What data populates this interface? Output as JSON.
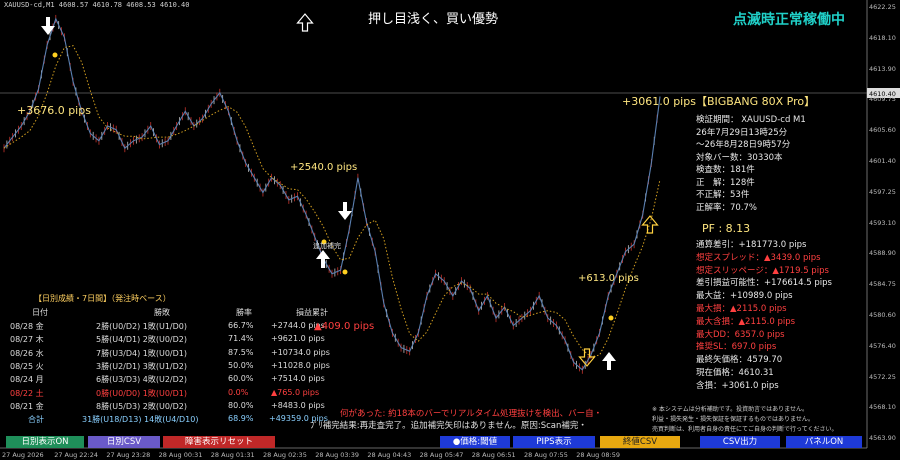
{
  "header": {
    "symbol_line": "XAUUSD-cd,M1  4608.57 4610.78 4608.53 4610.40"
  },
  "signal_text": "押し目浅く、買い優勢",
  "status_text": "点滅時正常稼働中",
  "pips_labels": [
    "+3676.0 pips",
    "+2540.0 pips",
    "+613.0 pips",
    "+3061.0 pips"
  ],
  "mid_label": "追加補完",
  "current_price_tag": "4610.40",
  "y_axis": [
    "4622.25",
    "4618.10",
    "4613.90",
    "4609.75",
    "4605.60",
    "4601.40",
    "4597.25",
    "4593.10",
    "4588.90",
    "4584.75",
    "4580.60",
    "4576.40",
    "4572.25",
    "4568.10",
    "4563.90"
  ],
  "x_axis": [
    "27 Aug 2026",
    "27 Aug 22:24",
    "27 Aug 23:28",
    "28 Aug 00:31",
    "28 Aug 01:31",
    "28 Aug 02:35",
    "28 Aug 03:39",
    "28 Aug 04:43",
    "28 Aug 05:47",
    "28 Aug 06:51",
    "28 Aug 07:55",
    "28 Aug 08:59"
  ],
  "panel_right": {
    "title": "【BIGBANG 80X Pro】",
    "lines": [
      {
        "t": "検証期間：  XAUUSD-cd M1",
        "red": false
      },
      {
        "t": "26年7月29日13時25分",
        "red": false
      },
      {
        "t": "～26年8月28日9時57分",
        "red": false
      },
      {
        "t": "対象バー数：30330本",
        "red": false
      },
      {
        "t": "検査数：181件",
        "red": false
      },
      {
        "t": "正　解：128件",
        "red": false
      },
      {
        "t": "不正解：53件",
        "red": false
      },
      {
        "t": "正解率：70.7%",
        "red": false
      }
    ],
    "pf": "PF  : 8.13",
    "lines2": [
      {
        "t": "通算差引：+181773.0 pips",
        "red": false
      },
      {
        "t": "想定スプレッド：▲3439.0 pips",
        "red": true
      },
      {
        "t": "想定スリッページ：▲1719.5 pips",
        "red": true
      },
      {
        "t": "差引損益可能性：+176614.5 pips",
        "red": false
      },
      {
        "t": "最大益：+10989.0 pips",
        "red": false
      },
      {
        "t": "最大損：▲2115.0 pips",
        "red": true
      },
      {
        "t": "最大含損：▲2115.0 pips",
        "red": true
      },
      {
        "t": "最大DD：6357.0 pips",
        "red": true
      },
      {
        "t": "推奨SL：697.0 pips",
        "red": true
      },
      {
        "t": "最終矢価格：4579.70",
        "red": false
      },
      {
        "t": "現在価格：4610.31",
        "red": false
      },
      {
        "t": "含損：+3061.0 pips",
        "red": false
      }
    ]
  },
  "daily_table": {
    "caption": "【日別成績・7日間】（発注時ベース）",
    "headers": [
      "日付",
      "勝敗",
      "勝率",
      "損益累計"
    ],
    "rows": [
      {
        "d": "08/28 金",
        "wl": "2勝(U0/D2) 1敗(U1/D0)",
        "rate": "66.7%",
        "pl": "+2744.0 pips",
        "red": false
      },
      {
        "d": "08/27 木",
        "wl": "5勝(U4/D1) 2敗(U0/D2)",
        "rate": "71.4%",
        "pl": "+9621.0 pips",
        "red": false
      },
      {
        "d": "08/26 水",
        "wl": "7勝(U3/D4) 1敗(U0/D1)",
        "rate": "87.5%",
        "pl": "+10734.0 pips",
        "red": false
      },
      {
        "d": "08/25 火",
        "wl": "3勝(U2/D1) 3敗(U1/D2)",
        "rate": "50.0%",
        "pl": "+11028.0 pips",
        "red": false
      },
      {
        "d": "08/24 月",
        "wl": "6勝(U3/D3) 4敗(U2/D2)",
        "rate": "60.0%",
        "pl": "+7514.0 pips",
        "red": false
      },
      {
        "d": "08/22 土",
        "wl": "0勝(U0/D0) 1敗(U0/D1)",
        "rate": "0.0%",
        "pl": "▲765.0 pips",
        "red": true
      },
      {
        "d": "08/21 金",
        "wl": "8勝(U5/D3) 2敗(U0/D2)",
        "rate": "80.0%",
        "pl": "+8483.0 pips",
        "red": false
      }
    ],
    "total": {
      "d": "合計",
      "wl": "31勝(U18/D13) 14敗(U4/D10)",
      "rate": "68.9%",
      "pl": "+49359.0 pips"
    },
    "overlap_text": "▲409.0 pips"
  },
  "message": {
    "line1": "何があった: 約18本のバーでリアルタイム処理抜けを検出、バー自・",
    "line2": "ﾌﾟﾘ補完結果:再走査完了。追加補完矢印はありません。原因:Scan補完・"
  },
  "notes": [
    "※ 本システムは分析補助です。投資助言ではありません。",
    "利益・損失発生・損失保証を保証するものではありません。",
    "売買判断は、利用者自身の責任にてご自身の判断で行ってください。"
  ],
  "buttons_left": [
    {
      "label": "日別表示ON",
      "bg": "#1f8f5a"
    },
    {
      "label": "日別CSV",
      "bg": "#6a5ac8"
    },
    {
      "label": "障害表示リセット",
      "bg": "#c02828"
    }
  ],
  "buttons_right": [
    {
      "label": "●価格:閾値",
      "bg": "#1e3ad8"
    },
    {
      "label": "PIPS表示",
      "bg": "#1e3ad8"
    },
    {
      "label": "終値CSV",
      "bg": "#e8a810"
    },
    {
      "label": "CSV出力",
      "bg": "#1e3ad8"
    },
    {
      "label": "パネルON",
      "bg": "#1e3ad8"
    }
  ],
  "chart_data": {
    "type": "line",
    "price_line_color": "#5a7fb0",
    "ma_color": "#d4a020",
    "current_price": 4610.4,
    "series": [
      {
        "values": [
          4603,
          4604.5,
          4606,
          4608,
          4611,
          4617,
          4620.5,
          4618,
          4612,
          4608,
          4605,
          4604,
          4606,
          4605.5,
          4603,
          4604,
          4604.5,
          4606,
          4603.5,
          4604,
          4606,
          4608,
          4606,
          4607,
          4609,
          4610.5,
          4608,
          4604,
          4601,
          4599,
          4597,
          4599,
          4598,
          4596,
          4596.5,
          4594,
          4591,
          4588,
          4586,
          4586.5,
          4592,
          4599,
          4593,
          4589,
          4582,
          4578,
          4576,
          4575.5,
          4578,
          4583,
          4586,
          4585,
          4583,
          4585,
          4584,
          4581,
          4583,
          4580,
          4581.5,
          4579,
          4580,
          4581,
          4583,
          4580,
          4579,
          4577,
          4574,
          4573,
          4575,
          4578,
          4583,
          4586,
          4589,
          4590,
          4594,
          4601,
          4610
        ]
      }
    ]
  }
}
